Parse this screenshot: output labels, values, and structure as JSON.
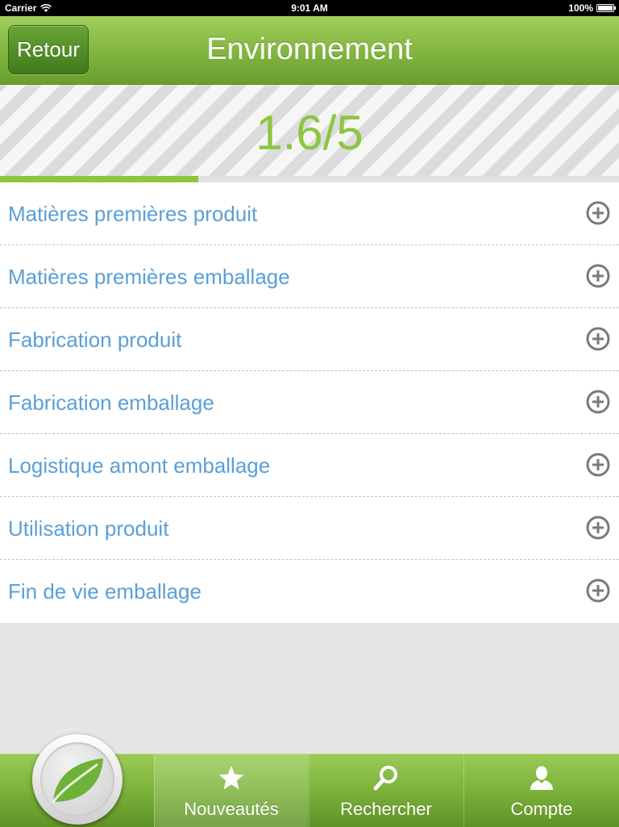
{
  "status_bar": {
    "carrier": "Carrier",
    "time": "9:01 AM",
    "battery": "100%"
  },
  "nav": {
    "back_label": "Retour",
    "title": "Environnement"
  },
  "score": {
    "text": "1.6/5",
    "value": 1.6,
    "max": 5
  },
  "list": {
    "items": [
      {
        "label": "Matières premières produit",
        "icon": "plus-circle-icon"
      },
      {
        "label": "Matières premières emballage",
        "icon": "plus-circle-icon"
      },
      {
        "label": "Fabrication produit",
        "icon": "plus-circle-icon"
      },
      {
        "label": "Fabrication emballage",
        "icon": "plus-circle-icon"
      },
      {
        "label": "Logistique amont emballage",
        "icon": "plus-circle-icon"
      },
      {
        "label": "Utilisation produit",
        "icon": "plus-circle-icon"
      },
      {
        "label": "Fin de vie emballage",
        "icon": "plus-circle-icon"
      }
    ]
  },
  "tabs": [
    {
      "label": "Nouveautés",
      "icon": "star-icon",
      "selected": true
    },
    {
      "label": "Rechercher",
      "icon": "search-icon",
      "selected": false
    },
    {
      "label": "Compte",
      "icon": "user-icon",
      "selected": false
    }
  ],
  "colors": {
    "accent_green": "#8cc63f",
    "list_text_blue": "#5b9fd6",
    "nav_green": "#86b944"
  }
}
